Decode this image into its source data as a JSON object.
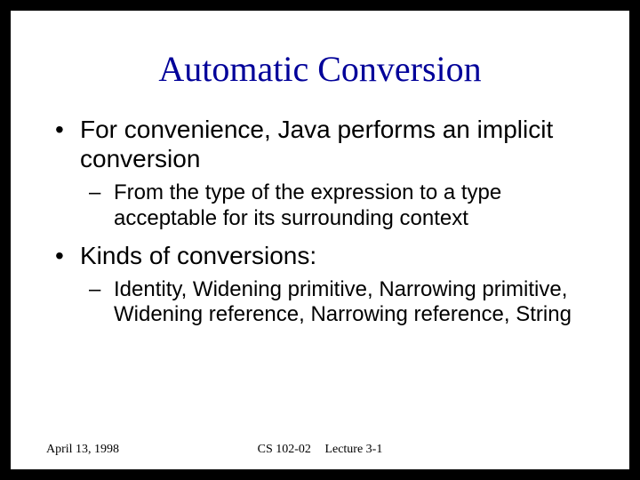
{
  "slide": {
    "title": "Automatic Conversion",
    "bullets": [
      {
        "text": "For convenience, Java performs an implicit conversion",
        "sub": [
          "From the type of the expression to a type acceptable for its surrounding context"
        ]
      },
      {
        "text": "Kinds of conversions:",
        "sub": [
          "Identity, Widening primitive, Narrowing primitive, Widening reference, Narrowing reference, String"
        ]
      }
    ],
    "footer": {
      "date": "April 13, 1998",
      "course": "CS 102-02",
      "lecture": "Lecture 3-1"
    }
  }
}
